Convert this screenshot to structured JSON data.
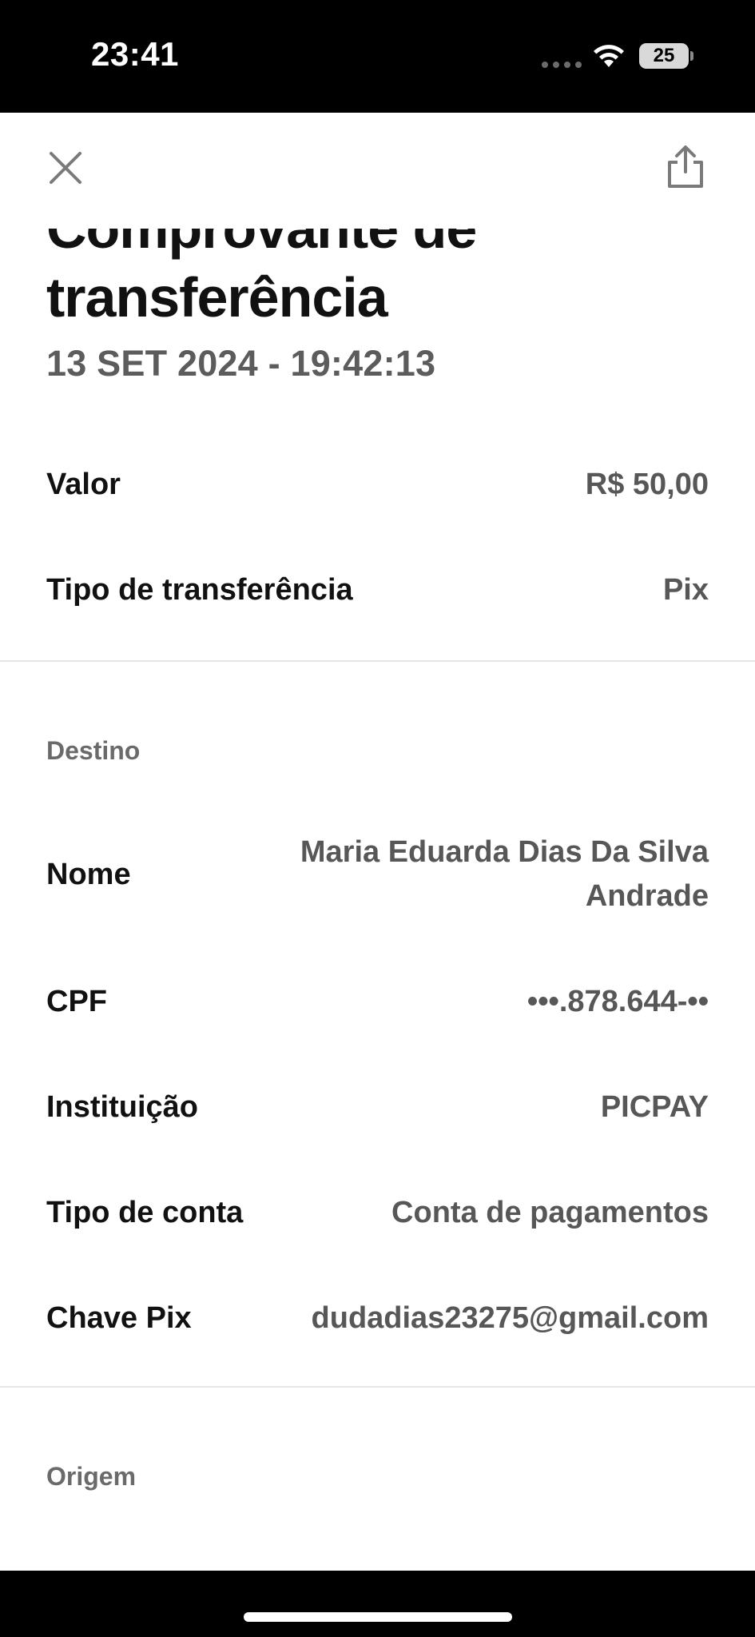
{
  "status_bar": {
    "time": "23:41",
    "battery": "25"
  },
  "header": {
    "close_icon": "close-icon",
    "share_icon": "share-icon"
  },
  "title": "Comprovante de transferência",
  "date": "13 SET 2024 - 19:42:13",
  "summary": {
    "valor_label": "Valor",
    "valor_value": "R$ 50,00",
    "tipo_label": "Tipo de transferência",
    "tipo_value": "Pix"
  },
  "destino": {
    "heading": "Destino",
    "nome_label": "Nome",
    "nome_value": "Maria Eduarda Dias Da Silva Andrade",
    "cpf_label": "CPF",
    "cpf_value": "•••.878.644-••",
    "instituicao_label": "Instituição",
    "instituicao_value": "PICPAY",
    "tipo_conta_label": "Tipo de conta",
    "tipo_conta_value": "Conta de pagamentos",
    "chave_label": "Chave Pix",
    "chave_value": "dudadias23275@gmail.com"
  },
  "origem": {
    "heading": "Origem"
  },
  "colors": {
    "background": "#ffffff",
    "label": "#111111",
    "value": "#575757",
    "section_heading": "#6a6a6a",
    "divider": "#e6e6e6"
  }
}
